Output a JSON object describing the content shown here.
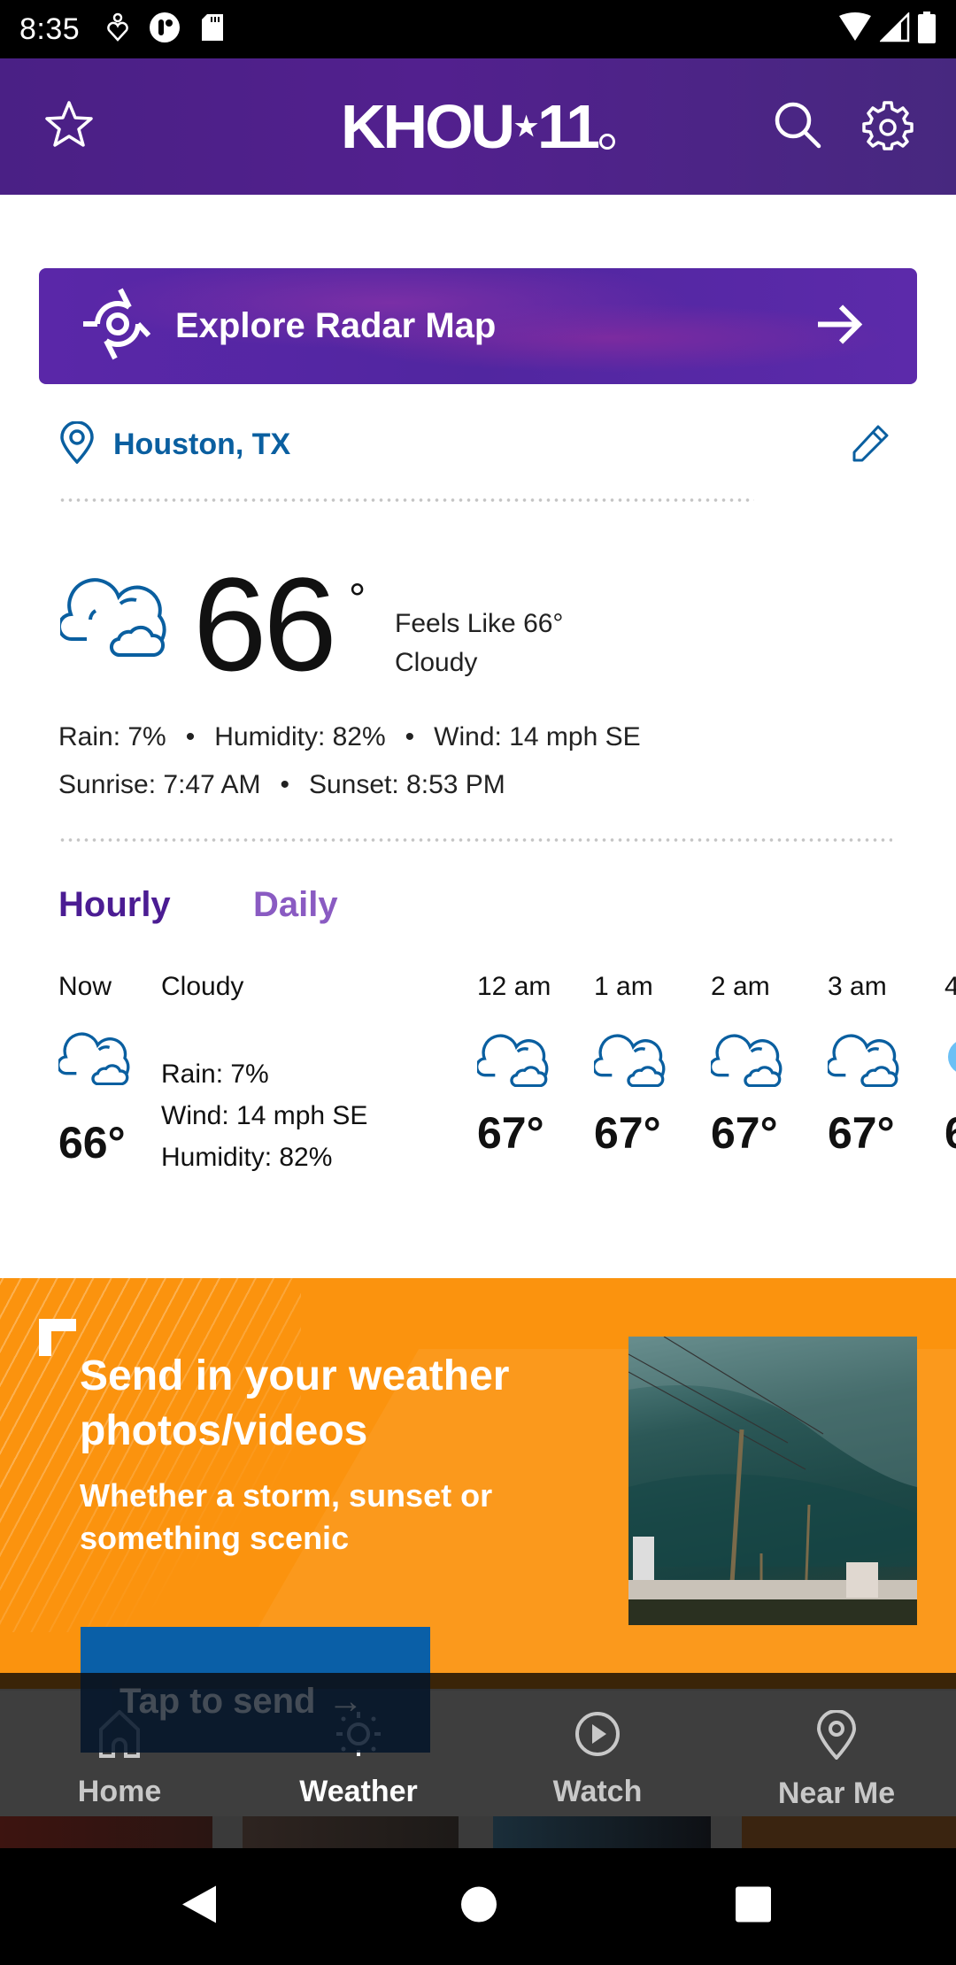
{
  "status_bar": {
    "time": "8:35",
    "left_icons": [
      "location-heart-icon",
      "notification-app-icon",
      "sd-card-icon"
    ],
    "right_icons": [
      "wifi-icon",
      "signal-icon",
      "battery-icon"
    ]
  },
  "header": {
    "logo_text": "KHOU",
    "logo_number": "11",
    "logo_star": "★",
    "favorite_icon": "star-icon",
    "search_icon": "search-icon",
    "settings_icon": "gear-icon",
    "brand_color": "#4f208a"
  },
  "radar": {
    "label": "Explore Radar Map",
    "icon": "radar-icon",
    "arrow_icon": "arrow-right-icon"
  },
  "location": {
    "name": "Houston, TX",
    "icon": "map-pin-icon",
    "edit_icon": "pencil-icon",
    "color": "#0a5fa0"
  },
  "current": {
    "temp": "66",
    "degree": "°",
    "feels_like": "Feels Like 66°",
    "condition": "Cloudy",
    "icon": "cloudy-icon",
    "rain": "Rain: 7%",
    "humidity": "Humidity: 82%",
    "wind": "Wind: 14 mph SE",
    "sunrise": "Sunrise: 7:47 AM",
    "sunset": "Sunset: 8:53 PM",
    "separator": "•"
  },
  "forecast_tabs": [
    {
      "label": "Hourly",
      "active": true
    },
    {
      "label": "Daily",
      "active": false
    }
  ],
  "hourly_now": {
    "label": "Now",
    "condition": "Cloudy",
    "temp": "66°",
    "rain": "Rain: 7%",
    "wind": "Wind: 14 mph SE",
    "humidity": "Humidity: 82%"
  },
  "hourly": [
    {
      "time": "12 am",
      "temp": "67°",
      "icon": "cloudy-icon"
    },
    {
      "time": "1 am",
      "temp": "67°",
      "icon": "cloudy-icon"
    },
    {
      "time": "2 am",
      "temp": "67°",
      "icon": "cloudy-icon"
    },
    {
      "time": "3 am",
      "temp": "67°",
      "icon": "cloudy-icon"
    },
    {
      "time": "4",
      "temp": "6",
      "icon": "partly-cloudy-icon"
    }
  ],
  "promo": {
    "title": "Send in your weather photos/videos",
    "subtitle": "Whether a storm, sunset or something scenic",
    "button_label": "Tap to send",
    "button_arrow": "→",
    "background_color": "#fb930e",
    "button_color": "#0a5fa7"
  },
  "bottom_nav": [
    {
      "label": "Home",
      "icon": "home-icon",
      "active": false
    },
    {
      "label": "Weather",
      "icon": "sun-icon",
      "active": true
    },
    {
      "label": "Watch",
      "icon": "play-circle-icon",
      "active": false
    },
    {
      "label": "Near Me",
      "icon": "map-pin-icon",
      "active": false
    }
  ],
  "system_nav": [
    "back-icon",
    "home-circle-icon",
    "recents-icon"
  ]
}
